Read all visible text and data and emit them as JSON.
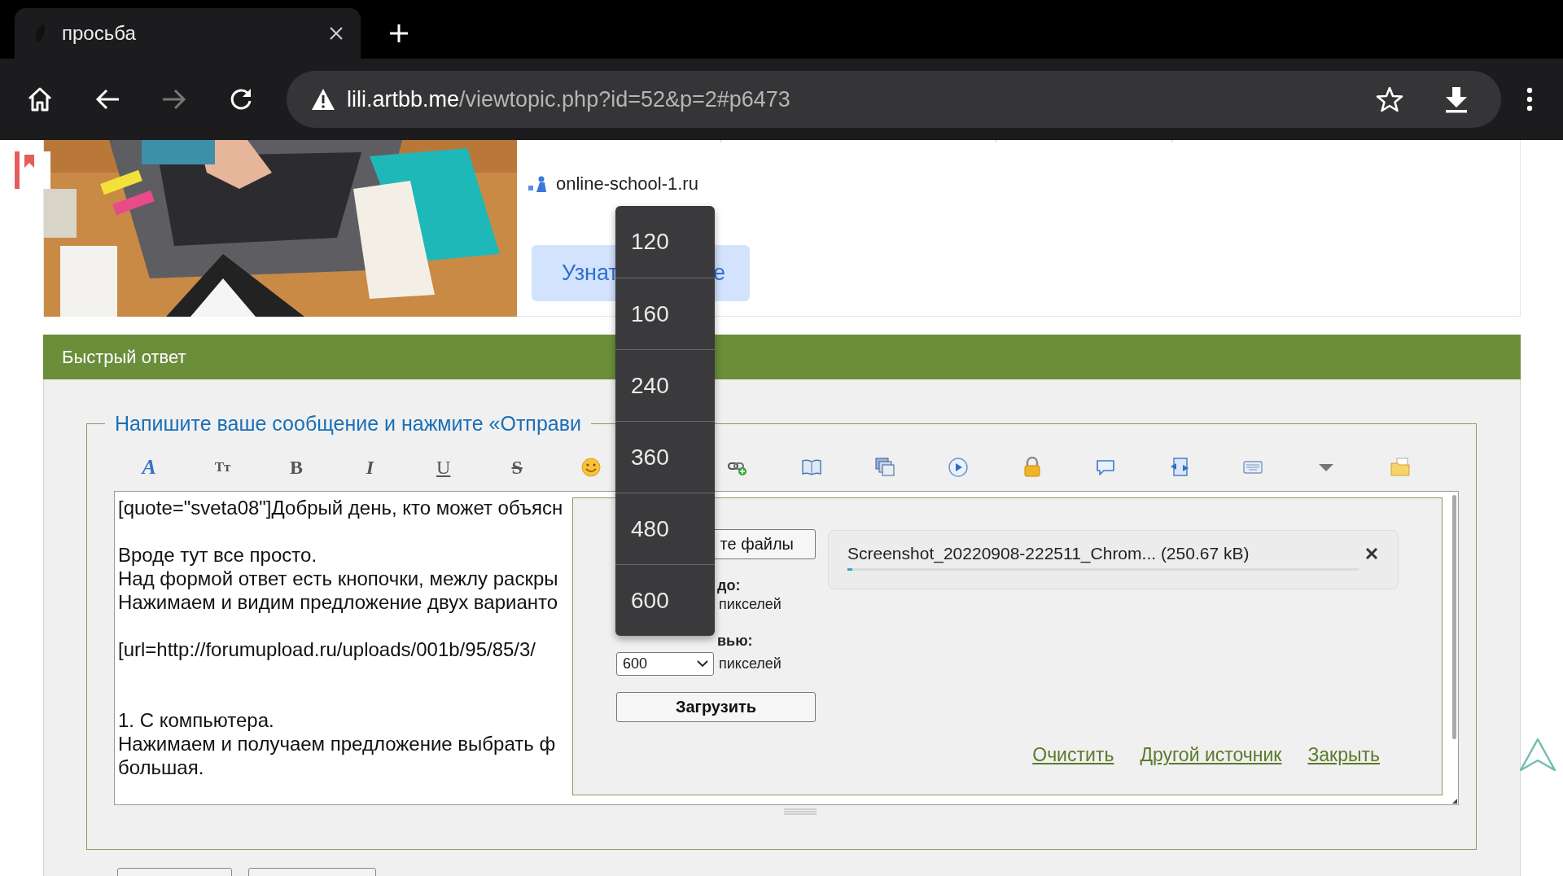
{
  "browser": {
    "tab": {
      "title": "просьба",
      "selected": true
    },
    "address": {
      "host": "lili.artbb.me",
      "path": "/viewtopic.php?id=52&p=2#p6473"
    }
  },
  "ad": {
    "site": "online-school-1.ru",
    "button": {
      "text_start": "Узнат",
      "text_end": "е"
    }
  },
  "quick_reply": {
    "title": "Быстрый ответ",
    "legend": "Напишите ваше сообщение и нажмите «Отправи",
    "toolbar": [
      {
        "text": "A",
        "kind": "fancy"
      },
      {
        "text": "Tт",
        "kind": "small"
      },
      {
        "text": "B",
        "kind": "bold"
      },
      {
        "text": "I",
        "kind": "italic"
      },
      {
        "text": "U",
        "kind": "underline"
      },
      {
        "text": "S",
        "kind": "strike"
      }
    ],
    "message": [
      {
        "kind": "first",
        "lines": [
          "[quote=\"sveta08\"]Добрый день, кто может объясн"
        ]
      },
      {
        "kind": "spaced",
        "lines": [
          "Вроде тут все просто.",
          "Над формой ответ есть кнопочки, межлу раскры",
          "Нажимаем и видим предложение двух варианто"
        ]
      },
      {
        "kind": "spaced",
        "lines": [
          "[url=http://forumupload.ru/uploads/001b/95/85/3/"
        ]
      },
      {
        "kind": "wide",
        "lines": [
          "1. С компьютера.",
          "Нажимаем и получаем предложение выбрать ф",
          "большая."
        ]
      }
    ],
    "upload": {
      "choose_button": "те файлы",
      "max_label": "до:",
      "max_unit": "пикселей",
      "preview_label": "вью:",
      "preview_select": "600",
      "preview_unit": "пикселей",
      "upload_button": "Загрузить",
      "files": [
        {
          "name": "Screenshot_20220908-222511_Chrom... (250.67 kB)",
          "level": 0.01
        }
      ],
      "links": [
        "Очистить",
        "Другой источник",
        "Закрыть"
      ]
    }
  },
  "size_menu": {
    "options": [
      "120",
      "160",
      "240",
      "360",
      "480",
      "600"
    ]
  }
}
